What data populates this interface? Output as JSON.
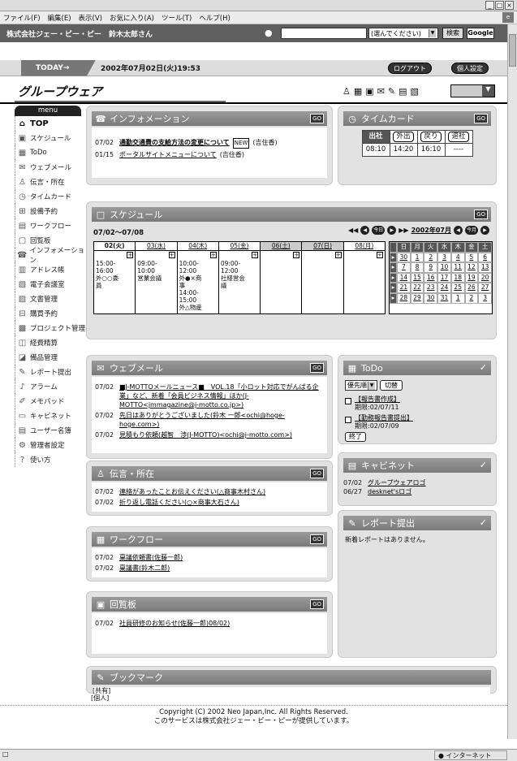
{
  "browser": {
    "menus": [
      "ファイル(F)",
      "編集(E)",
      "表示(V)",
      "お気に入り(A)",
      "ツール(T)",
      "ヘルプ(H)"
    ]
  },
  "header": {
    "company": "株式会社ジェー・ビー・ピー　鈴木太郎さん",
    "scope_select": "(選んでください)",
    "search_button": "検索",
    "google_button": "Google"
  },
  "datebar": {
    "today_label": "TODAY→",
    "datetime": "2002年07月02日(火)19:53",
    "logout": "ログアウト",
    "personal": "個人設定"
  },
  "app": {
    "title": "グループウェア"
  },
  "sidebar": {
    "menu_label": "menu",
    "items": [
      {
        "label": "TOP",
        "icon": "home-icon"
      },
      {
        "label": "スケジュール",
        "icon": "schedule-icon"
      },
      {
        "label": "ToDo",
        "icon": "todo-icon"
      },
      {
        "label": "ウェブメール",
        "icon": "mail-icon"
      },
      {
        "label": "伝言・所在",
        "icon": "person-icon"
      },
      {
        "label": "タイムカード",
        "icon": "clock-icon"
      },
      {
        "label": "設備予約",
        "icon": "facility-icon"
      },
      {
        "label": "ワークフロー",
        "icon": "workflow-icon"
      },
      {
        "label": "回覧板",
        "icon": "circular-icon"
      },
      {
        "label": "インフォメーション",
        "icon": "info-icon"
      },
      {
        "label": "アドレス帳",
        "icon": "address-icon"
      },
      {
        "label": "電子会議室",
        "icon": "conference-icon"
      },
      {
        "label": "文書管理",
        "icon": "document-icon"
      },
      {
        "label": "購買予約",
        "icon": "purchase-icon"
      },
      {
        "label": "プロジェクト管理",
        "icon": "project-icon"
      },
      {
        "label": "経費精算",
        "icon": "expense-icon"
      },
      {
        "label": "備品管理",
        "icon": "equipment-icon"
      },
      {
        "label": "レポート提出",
        "icon": "report-icon"
      },
      {
        "label": "アラーム",
        "icon": "alarm-icon"
      },
      {
        "label": "メモパッド",
        "icon": "memo-icon"
      },
      {
        "label": "キャビネット",
        "icon": "cabinet-icon"
      },
      {
        "label": "ユーザー名簿",
        "icon": "users-icon"
      },
      {
        "label": "管理者設定",
        "icon": "admin-icon"
      },
      {
        "label": "使い方",
        "icon": "help-icon"
      }
    ]
  },
  "info": {
    "title": "インフォメーション",
    "items": [
      {
        "date": "07/02",
        "text": "通勤交通費の支給方法の変更について",
        "note": "(吉住香)"
      },
      {
        "date": "01/15",
        "text": "ポータルサイトメニューについて",
        "note": "(吉住香)"
      }
    ]
  },
  "timecard": {
    "title": "タイムカード",
    "headers": [
      "出社",
      "外出",
      "戻り",
      "退社"
    ],
    "values": [
      "08:10",
      "14:20",
      "16:10",
      "----"
    ]
  },
  "schedule": {
    "title": "スケジュール",
    "range": "07/02～07/08",
    "month_label": "2002年07月",
    "days": [
      {
        "label": "02(火)",
        "events": [
          "15:00-",
          "16:00",
          "外○○委",
          "員"
        ]
      },
      {
        "label": "03(水)",
        "events": [
          "09:00-",
          "10:00",
          "営業会議"
        ]
      },
      {
        "label": "04(木)",
        "events": [
          "10:00-",
          "12:00",
          "外●×商",
          "事",
          "14:00-",
          "15:00",
          "外△物産"
        ]
      },
      {
        "label": "05(金)",
        "events": [
          "09:00-",
          "12:00",
          "社経営会",
          "議"
        ]
      },
      {
        "label": "06(土)",
        "events": []
      },
      {
        "label": "07(日)",
        "events": []
      },
      {
        "label": "08(月)",
        "events": []
      }
    ],
    "mini_headers": [
      "日",
      "月",
      "火",
      "水",
      "木",
      "金",
      "土"
    ],
    "mini_weeks": [
      [
        "30",
        "1",
        "2",
        "3",
        "4",
        "5",
        "6"
      ],
      [
        "7",
        "8",
        "9",
        "10",
        "11",
        "12",
        "13"
      ],
      [
        "14",
        "15",
        "16",
        "17",
        "18",
        "19",
        "20"
      ],
      [
        "21",
        "22",
        "23",
        "24",
        "25",
        "26",
        "27"
      ],
      [
        "28",
        "29",
        "30",
        "31",
        "1",
        "2",
        "3"
      ]
    ]
  },
  "webmail": {
    "title": "ウェブメール",
    "items": [
      {
        "date": "07/02",
        "text": "■J-MOTTOメールニュース■　VOL.18「小ロット対応でがんばる企業」など、新着「会員ビジネス情報」ほか(J-MOTTO<jmmagazine@j-motto.co.jp>)"
      },
      {
        "date": "07/02",
        "text": "先日はありがとうございました(鈴木 一郎<ochi@hoge-hoge.com>)"
      },
      {
        "date": "07/02",
        "text": "見積もり依頼(越智　渉(J-MOTTO)<ochi@j-motto.com>)"
      }
    ]
  },
  "todo": {
    "title": "ToDo",
    "priority": "優先順",
    "switch": "切替",
    "end": "終了",
    "items": [
      {
        "title": "【報告書作成】",
        "due": "期限:02/07/11"
      },
      {
        "title": "【勤務報告書提出】",
        "due": "期限:02/07/09"
      }
    ]
  },
  "message": {
    "title": "伝言・所在",
    "items": [
      {
        "date": "07/02",
        "text": "連絡があったことお伝えください(△商事木村さん)"
      },
      {
        "date": "07/02",
        "text": "折り返し電話ください(○×商事大石さん)"
      }
    ]
  },
  "cabinet": {
    "title": "キャビネット",
    "items": [
      {
        "date": "07/02",
        "text": "グループウェアロゴ"
      },
      {
        "date": "06/27",
        "text": "desknet'sロゴ"
      }
    ]
  },
  "workflow": {
    "title": "ワークフロー",
    "items": [
      {
        "date": "07/02",
        "text": "稟議依頼書(佐藤一郎)"
      },
      {
        "date": "07/02",
        "text": "稟議書(鈴木二郎)"
      }
    ]
  },
  "report": {
    "title": "レポート提出",
    "empty": "新着レポートはありません。"
  },
  "circular": {
    "title": "回覧板",
    "items": [
      {
        "date": "07/02",
        "text": "社員研修のお知らせ(佐藤一郎)08/02)"
      }
    ]
  },
  "bookmark": {
    "title": "ブックマーク",
    "groups": [
      "[共有]",
      "[個人]"
    ]
  },
  "footer": {
    "line1": "Copyright (C) 2002 Neo Japan,Inc. All Rights Reserved.",
    "line2": "このサービスは株式会社ジェー・ビー・ピーが提供しています。"
  },
  "statusbar": {
    "zone": "インターネット"
  },
  "go_label": "GO"
}
